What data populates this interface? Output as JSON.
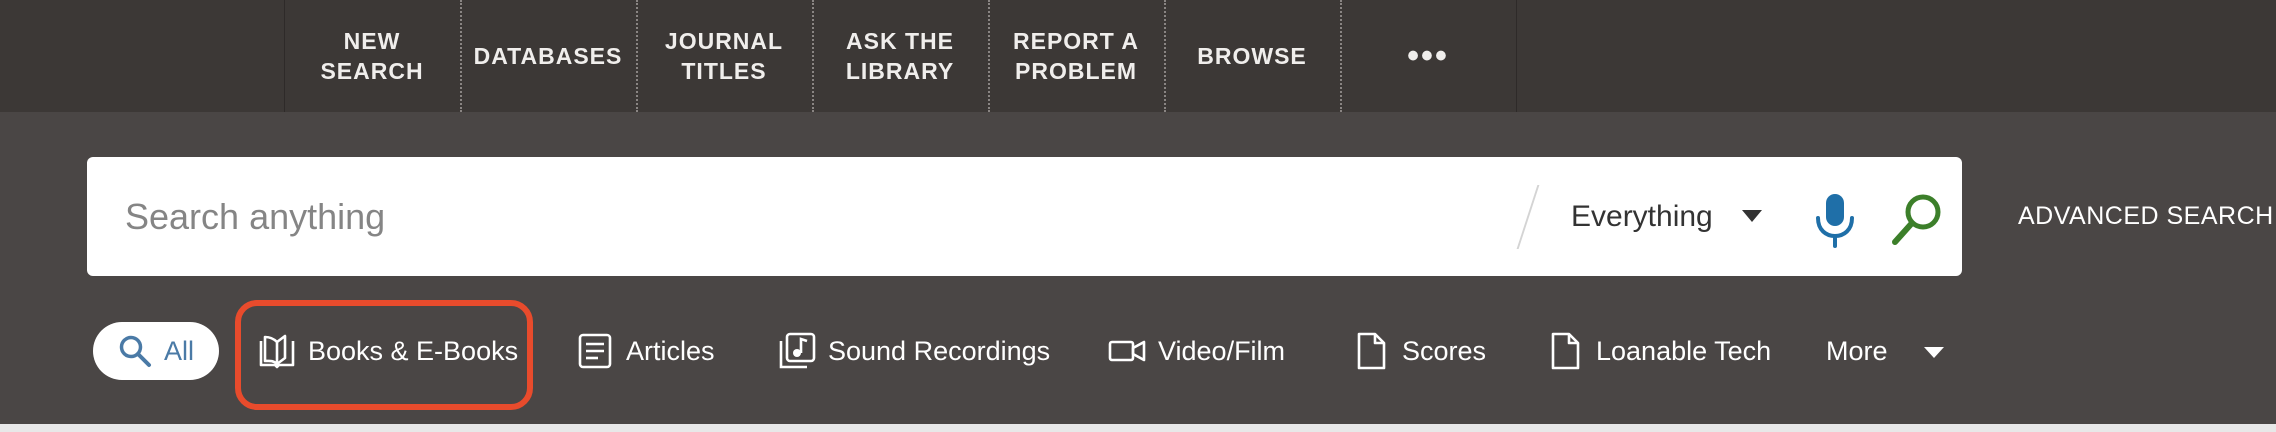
{
  "topnav": {
    "items": [
      {
        "label": "NEW\nSEARCH"
      },
      {
        "label": "DATABASES"
      },
      {
        "label": "JOURNAL\nTITLES"
      },
      {
        "label": "ASK THE\nLIBRARY"
      },
      {
        "label": "REPORT A\nPROBLEM"
      },
      {
        "label": "BROWSE"
      }
    ],
    "more_label": "•••"
  },
  "search": {
    "placeholder": "Search anything",
    "value": "",
    "scope_selected": "Everything",
    "mic_icon": "microphone-icon",
    "search_icon": "magnifier-icon",
    "advanced_label": "ADVANCED SEARCH"
  },
  "filters": {
    "all_label": "All",
    "items": [
      {
        "label": "Books & E-Books",
        "icon": "open-book-icon"
      },
      {
        "label": "Articles",
        "icon": "article-icon"
      },
      {
        "label": "Sound Recordings",
        "icon": "music-note-icon"
      },
      {
        "label": "Video/Film",
        "icon": "video-camera-icon"
      },
      {
        "label": "Scores",
        "icon": "document-icon"
      },
      {
        "label": "Loanable Tech",
        "icon": "document-icon"
      }
    ],
    "more_label": "More",
    "highlighted": "Books & E-Books"
  },
  "colors": {
    "nav_bg": "#3c3836",
    "page_bg": "#4a4645",
    "mic": "#1f6fa8",
    "search_icon": "#3c7f2a",
    "all_pill_text": "#4a7aa6",
    "highlight": "#e84b2c"
  }
}
